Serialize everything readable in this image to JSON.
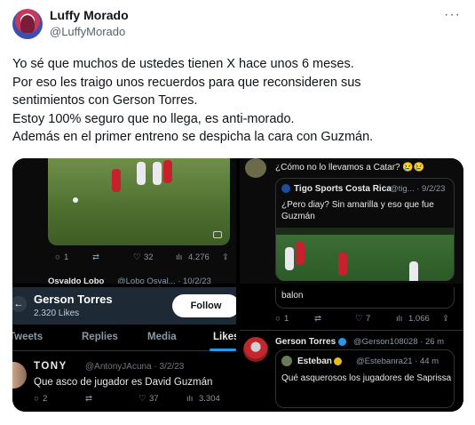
{
  "author": {
    "name": "Luffy Morado",
    "handle": "@LuffyMorado"
  },
  "more_label": "···",
  "tweet_lines": [
    "Yo sé que muchos de ustedes tienen X hace unos 6 meses.",
    "Por eso les traigo unos recuerdos para que reconsideren sus",
    "sentimientos con Gerson Torres.",
    "Estoy 100% seguro que no llega, es anti-morado.",
    "Además en el primer entreno se despicha la cara con Guzmán."
  ],
  "q1": {
    "actions": {
      "replies": "1",
      "retweets": "",
      "likes": "32",
      "views": "4.276"
    },
    "next_author": "Osvaldo Lobo",
    "next_meta": "@Lobo Osval... · 10/2/23"
  },
  "q2": {
    "reply_text": "¿Cómo no lo llevamos a Catar? 😢😢",
    "quoted_author": "Tigo Sports Costa Rica",
    "quoted_meta": "@tig... · 9/2/23",
    "quoted_text_1": "¿Pero diay? Sin amarilla y eso que fue",
    "quoted_text_2": "Guzmán"
  },
  "q3": {
    "back_icon": "←",
    "profile_name": "Gerson Torres",
    "profile_likes": "2.320 Likes",
    "follow_label": "Follow",
    "tabs": [
      "Tweets",
      "Replies",
      "Media",
      "Likes"
    ],
    "tweet_author": "TONY",
    "tweet_meta": "@AntonyJAcuna · 3/2/23",
    "tweet_text": "Que asco de jugador es David Guzmán",
    "actions": {
      "replies": "2",
      "retweets": "",
      "likes": "37",
      "views": "3.304"
    }
  },
  "q4": {
    "top_text": "balon",
    "actions": {
      "replies": "1",
      "retweets": "",
      "likes": "7",
      "views": "1.066"
    },
    "author": "Gerson Torres",
    "author_meta": "@Gerson108028 · 26 m",
    "quoted_author": "Esteban",
    "quoted_meta": "@Estebanra21 · 44 m",
    "quoted_text": "Qué asquerosos los jugadores de Saprissa"
  },
  "colors": {
    "accent": "#1d9bf0",
    "text": "#0f1419",
    "muted": "#536471"
  }
}
